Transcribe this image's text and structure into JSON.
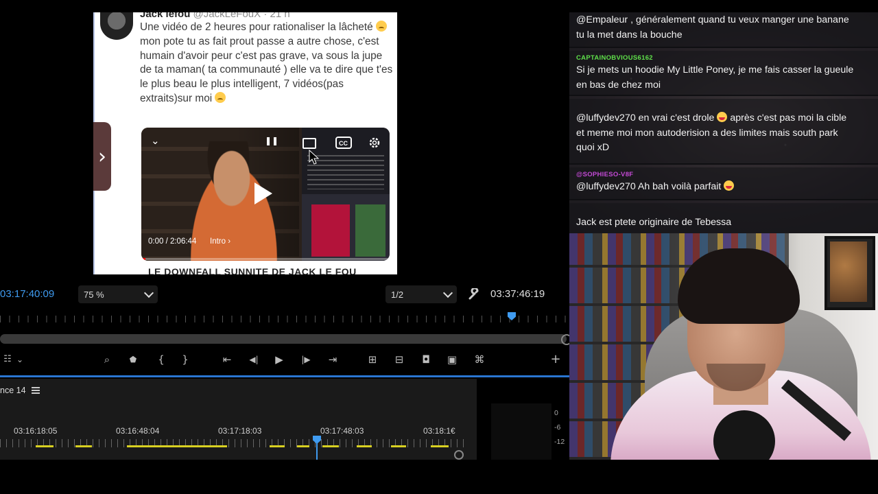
{
  "tweet": {
    "author": "Jack lefou",
    "handle_meta": "@JackLeFouX · 21 h",
    "text_before_emoji": "Une vidéo de 2 heures pour rationaliser la lâcheté",
    "text_middle": "mon pote tu as fait prout passe a autre chose, c'est humain d'avoir peur c'est pas grave, va sous la jupe de ta maman( ta communauté ) elle va te dire que t'es le plus beau le plus intelligent, 7 vidéos(pas extraits)sur moi",
    "video": {
      "time": "0:00 / 2:06:44",
      "chapter": "Intro",
      "progress": 0.0
    },
    "next_title": "LE DOWNFALL SUNNITE DE JACK LE FOU"
  },
  "program_monitor": {
    "timecode_left": "03:17:40:09",
    "zoom": "75 %",
    "resolution": "1/2",
    "timecode_right": "03:37:46:19"
  },
  "timeline": {
    "sequence_tab": "nce 14",
    "labels": [
      "03:16:18:05",
      "03:16:48:04",
      "03:17:18:03",
      "03:17:48:03",
      "03:18:1€"
    ],
    "meter_scale": [
      "0",
      "-6",
      "-12"
    ]
  },
  "chat": {
    "messages": [
      {
        "user": "",
        "user_color": "#ffffff",
        "text_lines": [
          "@Empaleur , généralement quand tu veux manger une banane",
          "tu la met dans la bouche"
        ]
      },
      {
        "user": "CAPTAINOBVIOUS6162",
        "user_color": "#5fe04a",
        "text_lines": [
          "Si je mets un hoodie My Little Poney, je me fais casser la gueule",
          "en bas de chez moi"
        ]
      },
      {
        "user": "",
        "user_color": "#d23a3a",
        "text_lines": [
          "@luffydev270 en vrai c'est drole",
          "et meme moi mon autoderision a des limites mais south park",
          "quoi xD"
        ],
        "emoji_after_first_part": true,
        "first_line_after_emoji": "après c'est pas moi la cible"
      },
      {
        "user": "@SOPHIESO-V8F",
        "user_color": "#c44ad6",
        "text_lines": [
          "@luffydev270 Ah bah voilà parfait"
        ],
        "emoji_end": true
      },
      {
        "user": "",
        "user_color": "#d23a3a",
        "text_lines": [
          "Jack est ptete originaire de Tebessa"
        ]
      }
    ]
  },
  "colors": {
    "accent": "#3f9bf0",
    "timeline_marker": "#d8d021"
  }
}
